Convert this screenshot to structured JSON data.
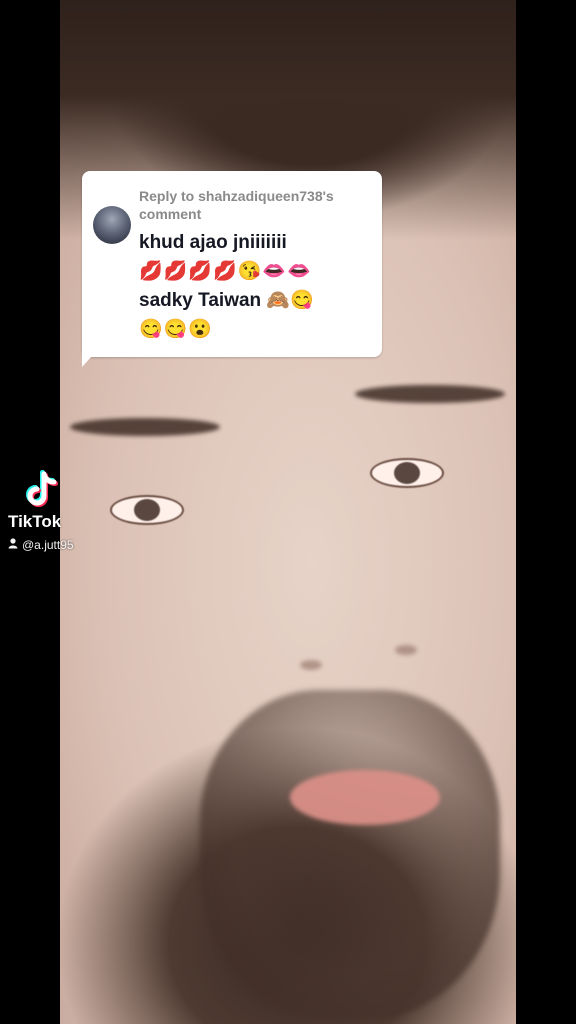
{
  "overlay": {
    "reply_header": "Reply to shahzadiqueen738's comment",
    "comment_line1": "khud ajao jniiiiiii",
    "comment_line2": "💋💋💋💋😘👄👄",
    "comment_line3": "sadky Taiwan 🙈😋",
    "comment_line4": "😋😋😮"
  },
  "watermark": {
    "brand": "TikTok",
    "handle": "@a.jutt95",
    "user_icon": "user-icon"
  },
  "colors": {
    "bubble_background": "#ffffff",
    "reply_text": "#8a8a8a",
    "comment_text": "#161823",
    "watermark_text": "#ffffff",
    "tiktok_cyan": "#25F4EE",
    "tiktok_red": "#FE2C55"
  }
}
